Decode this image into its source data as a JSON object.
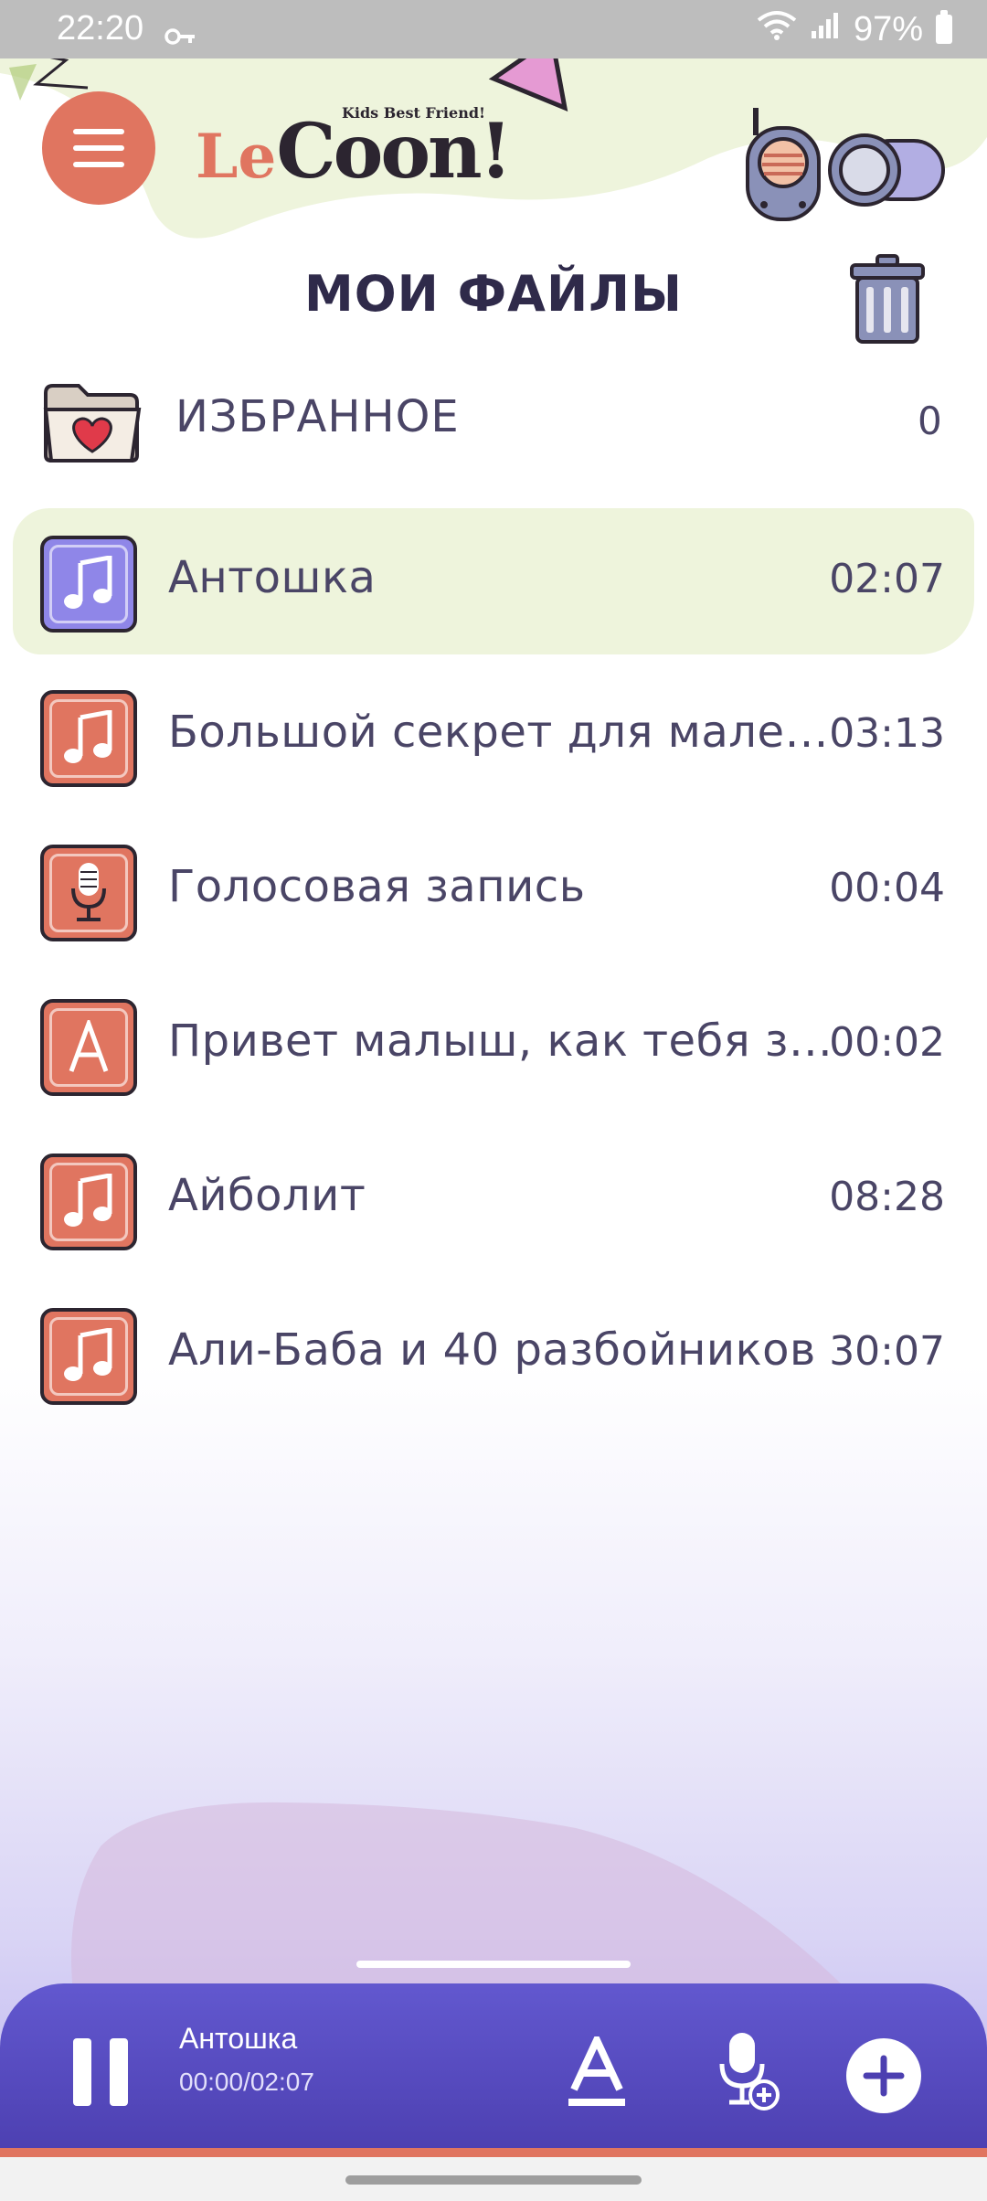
{
  "status": {
    "time": "22:20",
    "battery": "97%"
  },
  "header": {
    "logo_le": "Le",
    "logo_coon": "Coon!",
    "logo_tagline": "Kids Best Friend!",
    "page_title": "МОИ ФАЙЛЫ"
  },
  "favorites": {
    "label": "ИЗБРАННОЕ",
    "count": "0"
  },
  "files": [
    {
      "name": "Антошка",
      "duration": "02:07",
      "icon": "music-note-icon",
      "active": true
    },
    {
      "name": "Большой секрет для маленькой компании",
      "duration": "03:13",
      "icon": "music-note-icon",
      "active": false
    },
    {
      "name": "Голосовая запись",
      "duration": "00:04",
      "icon": "microphone-icon",
      "active": false
    },
    {
      "name": "Привет малыш, как тебя зовут",
      "duration": "00:02",
      "icon": "text-a-icon",
      "active": false
    },
    {
      "name": "Айболит",
      "duration": "08:28",
      "icon": "music-note-icon",
      "active": false
    },
    {
      "name": "Али-Баба и 40 разбойников",
      "duration": "30:07",
      "icon": "music-note-icon",
      "active": false
    }
  ],
  "player": {
    "title": "Антошка",
    "time": "00:00/02:07"
  },
  "colors": {
    "accent": "#e07560",
    "active_icon": "#8f86e8",
    "player": "#5448c0",
    "highlight": "#eef4dc"
  }
}
